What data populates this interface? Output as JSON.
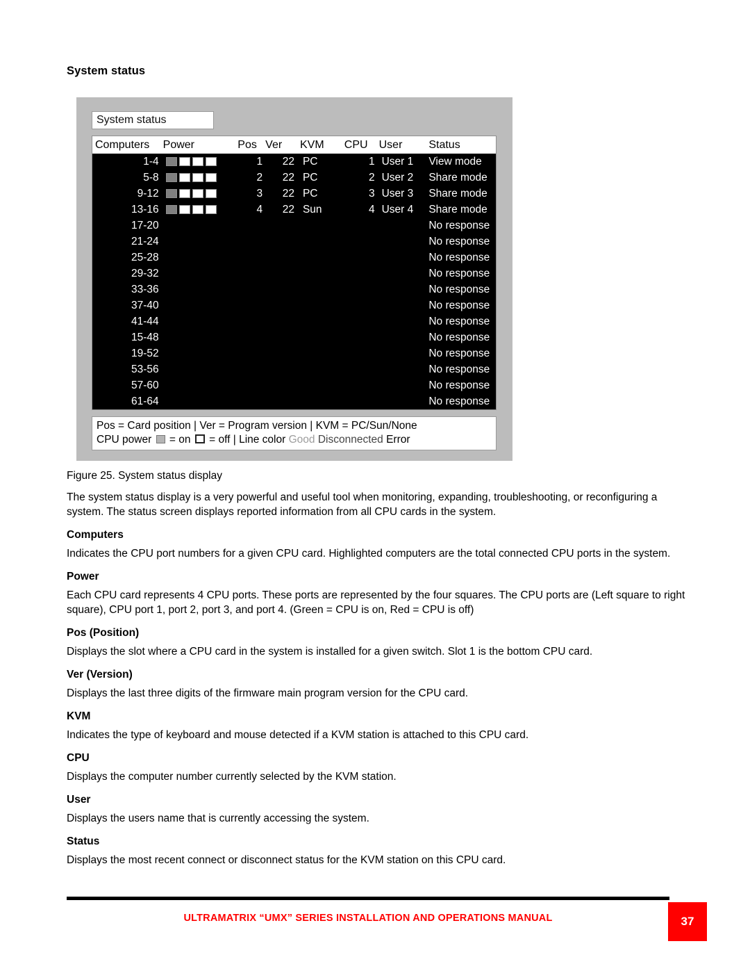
{
  "page_heading": "System status",
  "figure": {
    "title_chip": "System status",
    "table": {
      "columns": [
        "Computers",
        "Power",
        "Pos",
        "Ver",
        "KVM",
        "CPU",
        "User",
        "Status"
      ],
      "rows": [
        {
          "computers": "1-4",
          "power": [
            true,
            false,
            false,
            false
          ],
          "pos": "1",
          "ver": "22",
          "kvm": "PC",
          "cpu": "1",
          "user": "User 1",
          "status": "View mode"
        },
        {
          "computers": "5-8",
          "power": [
            true,
            false,
            false,
            false
          ],
          "pos": "2",
          "ver": "22",
          "kvm": "PC",
          "cpu": "2",
          "user": "User 2",
          "status": "Share mode"
        },
        {
          "computers": "9-12",
          "power": [
            true,
            false,
            false,
            false
          ],
          "pos": "3",
          "ver": "22",
          "kvm": "PC",
          "cpu": "3",
          "user": "User 3",
          "status": "Share mode"
        },
        {
          "computers": "13-16",
          "power": [
            true,
            false,
            false,
            false
          ],
          "pos": "4",
          "ver": "22",
          "kvm": "Sun",
          "cpu": "4",
          "user": "User 4",
          "status": "Share mode"
        },
        {
          "computers": "17-20",
          "power": [],
          "pos": "",
          "ver": "",
          "kvm": "",
          "cpu": "",
          "user": "",
          "status": "No response"
        },
        {
          "computers": "21-24",
          "power": [],
          "pos": "",
          "ver": "",
          "kvm": "",
          "cpu": "",
          "user": "",
          "status": "No response"
        },
        {
          "computers": "25-28",
          "power": [],
          "pos": "",
          "ver": "",
          "kvm": "",
          "cpu": "",
          "user": "",
          "status": "No response"
        },
        {
          "computers": "29-32",
          "power": [],
          "pos": "",
          "ver": "",
          "kvm": "",
          "cpu": "",
          "user": "",
          "status": "No response"
        },
        {
          "computers": "33-36",
          "power": [],
          "pos": "",
          "ver": "",
          "kvm": "",
          "cpu": "",
          "user": "",
          "status": "No response"
        },
        {
          "computers": "37-40",
          "power": [],
          "pos": "",
          "ver": "",
          "kvm": "",
          "cpu": "",
          "user": "",
          "status": "No response"
        },
        {
          "computers": "41-44",
          "power": [],
          "pos": "",
          "ver": "",
          "kvm": "",
          "cpu": "",
          "user": "",
          "status": "No response"
        },
        {
          "computers": "15-48",
          "power": [],
          "pos": "",
          "ver": "",
          "kvm": "",
          "cpu": "",
          "user": "",
          "status": "No response"
        },
        {
          "computers": "19-52",
          "power": [],
          "pos": "",
          "ver": "",
          "kvm": "",
          "cpu": "",
          "user": "",
          "status": "No response"
        },
        {
          "computers": "53-56",
          "power": [],
          "pos": "",
          "ver": "",
          "kvm": "",
          "cpu": "",
          "user": "",
          "status": "No response"
        },
        {
          "computers": "57-60",
          "power": [],
          "pos": "",
          "ver": "",
          "kvm": "",
          "cpu": "",
          "user": "",
          "status": "No response"
        },
        {
          "computers": "61-64",
          "power": [],
          "pos": "",
          "ver": "",
          "kvm": "",
          "cpu": "",
          "user": "",
          "status": "No response"
        }
      ]
    },
    "legend": {
      "line1": "Pos = Card position | Ver = Program version | KVM = PC/Sun/None",
      "line2_a": "CPU power",
      "line2_on": "= on",
      "line2_off": "= off",
      "line2_b": "| Line color",
      "color_good": "Good",
      "color_disconnected": "Disconnected",
      "color_error": "Error",
      "good_color": "#9d9d9d",
      "disconnected_color": "#444444",
      "error_color": "#000000"
    },
    "caption": "Figure 25. System status display"
  },
  "body": {
    "intro": "The system status display is a very powerful and useful tool when monitoring, expanding, troubleshooting, or reconfiguring a system.  The status screen displays reported information from all CPU cards in the system.",
    "sections": [
      {
        "heading": "Computers",
        "text": "Indicates the CPU port numbers for a given CPU card.  Highlighted computers are the total connected CPU ports in the system."
      },
      {
        "heading": "Power",
        "text": "Each CPU card represents 4 CPU ports.  These ports are represented by the four squares. The CPU ports are (Left square to right square), CPU port 1, port 2, port 3, and port 4. (Green = CPU is on, Red = CPU is off)"
      },
      {
        "heading": "Pos (Position)",
        "text": "Displays the slot where a CPU card in the system is installed for a given switch.  Slot 1 is the bottom CPU card."
      },
      {
        "heading": "Ver (Version)",
        "text": "Displays the last three digits of the firmware main program version for the CPU card."
      },
      {
        "heading": "KVM",
        "text": "Indicates the type of keyboard and mouse detected if a KVM station is attached to this CPU card."
      },
      {
        "heading": "CPU",
        "text": "Displays the computer number currently selected by the KVM station."
      },
      {
        "heading": "User",
        "text": "Displays the users name that is currently accessing the system."
      },
      {
        "heading": "Status",
        "text": "Displays the most recent connect or disconnect status for the KVM station on this CPU card."
      }
    ]
  },
  "footer": {
    "text": "ULTRAMATRIX “UMX” SERIES INSTALLATION AND OPERATIONS MANUAL",
    "page_number": "37",
    "accent_color": "#ff0000"
  }
}
